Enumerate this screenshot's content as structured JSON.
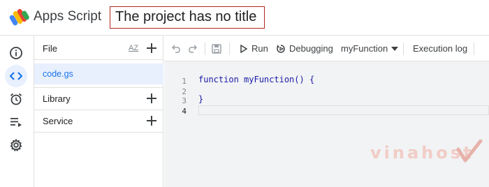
{
  "header": {
    "app_name": "Apps Script",
    "project_title": "The project has no title"
  },
  "rail": {
    "items": [
      {
        "icon": "info-icon"
      },
      {
        "icon": "code-icon",
        "active": true
      },
      {
        "icon": "alarm-clock-icon"
      },
      {
        "icon": "executions-list-icon"
      },
      {
        "icon": "gear-icon"
      }
    ]
  },
  "panel": {
    "file_label": "File",
    "sort_label": "AZ",
    "files": [
      {
        "name": "code.gs"
      }
    ],
    "library_label": "Library",
    "service_label": "Service"
  },
  "toolbar": {
    "run_label": "Run",
    "debug_label": "Debugging",
    "function_select": "myFunction",
    "exec_log_label": "Execution log"
  },
  "editor": {
    "lines": [
      {
        "no": "1",
        "text": "function myFunction() {"
      },
      {
        "no": "2",
        "text": ""
      },
      {
        "no": "3",
        "text": "}"
      },
      {
        "no": "4",
        "text": ""
      }
    ]
  },
  "watermark": {
    "text": "vinahost"
  },
  "colors": {
    "accent": "#1a73e8",
    "active_bg": "#e8f0fe",
    "title_border": "#b3261e",
    "editor_bg": "#f1f3f4"
  }
}
